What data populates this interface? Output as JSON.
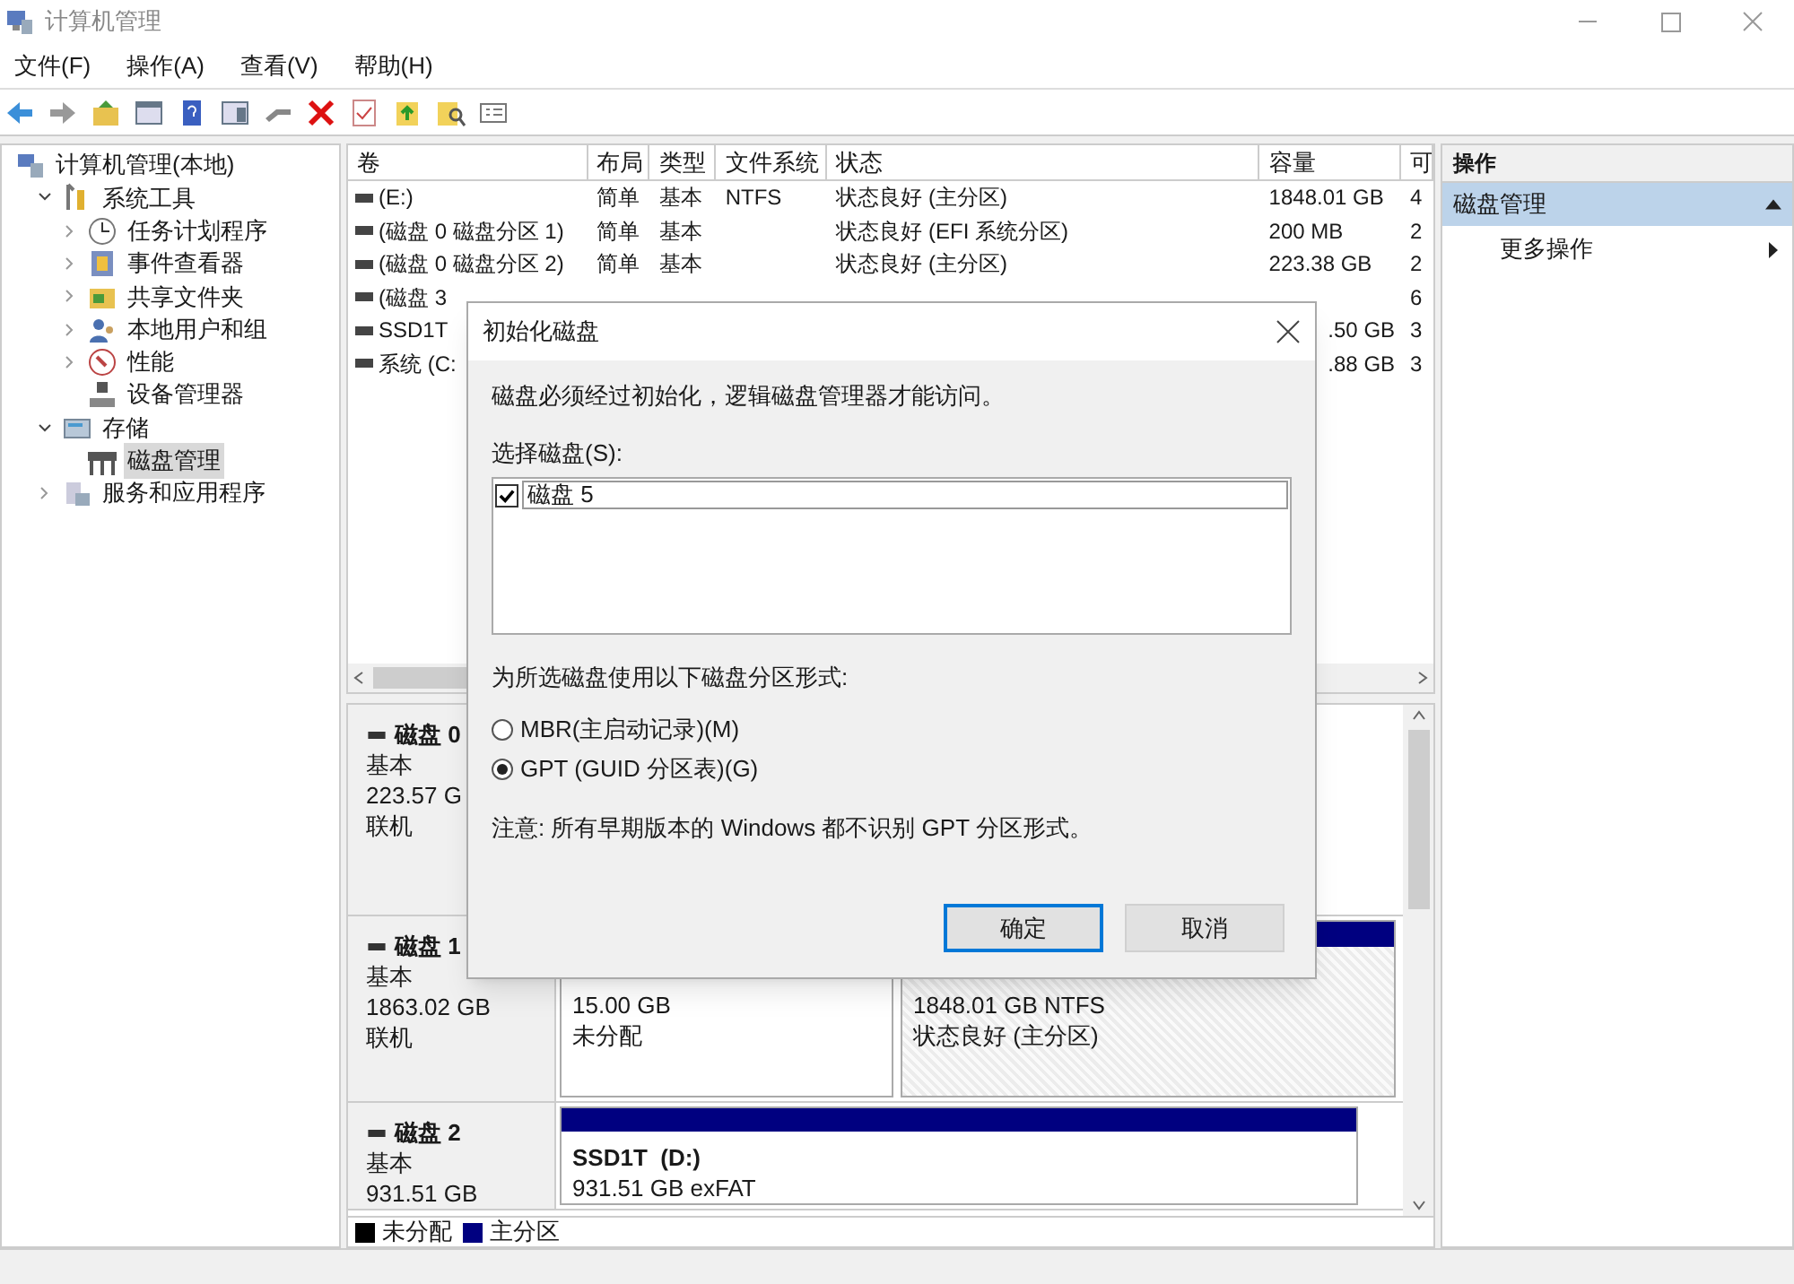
{
  "window": {
    "title": "计算机管理"
  },
  "menu": [
    "文件(F)",
    "操作(A)",
    "查看(V)",
    "帮助(H)"
  ],
  "tree": [
    {
      "label": "计算机管理(本地)",
      "selected": false,
      "children": [
        {
          "label": "系统工具",
          "expanded": true,
          "selected": false,
          "children": [
            {
              "label": "任务计划程序",
              "expanded": false,
              "selected": false
            },
            {
              "label": "事件查看器",
              "expanded": false,
              "selected": false
            },
            {
              "label": "共享文件夹",
              "expanded": false,
              "selected": false
            },
            {
              "label": "本地用户和组",
              "expanded": false,
              "selected": false
            },
            {
              "label": "性能",
              "expanded": false,
              "selected": false
            },
            {
              "label": "设备管理器",
              "selected": false
            }
          ]
        },
        {
          "label": "存储",
          "expanded": true,
          "selected": false,
          "children": [
            {
              "label": "磁盘管理",
              "selected": true
            }
          ]
        },
        {
          "label": "服务和应用程序",
          "expanded": false,
          "selected": false
        }
      ]
    }
  ],
  "table": {
    "columns": [
      "卷",
      "布局",
      "类型",
      "文件系统",
      "状态",
      "容量",
      "可"
    ],
    "rows": [
      {
        "cells": [
          "(E:)",
          "简单",
          "基本",
          "NTFS",
          "状态良好 (主分区)",
          "1848.01 GB",
          "4"
        ]
      },
      {
        "cells": [
          "(磁盘 0 磁盘分区 1)",
          "简单",
          "基本",
          null,
          "状态良好 (EFI 系统分区)",
          "200 MB",
          "2"
        ]
      },
      {
        "cells": [
          "(磁盘 0 磁盘分区 2)",
          "简单",
          "基本",
          null,
          "状态良好 (主分区)",
          "223.38 GB",
          "2"
        ]
      },
      {
        "cells": [
          "(磁盘 3",
          null,
          null,
          null,
          null,
          null,
          "6"
        ]
      },
      {
        "cells": [
          "SSD1T",
          null,
          null,
          null,
          null,
          ".50 GB",
          "3"
        ]
      },
      {
        "cells": [
          "系统 (C:",
          null,
          null,
          null,
          null,
          ".88 GB",
          "3"
        ]
      }
    ]
  },
  "disks": [
    {
      "name": "磁盘 0",
      "type": "基本",
      "size": "223.57 G",
      "status": "联机"
    },
    {
      "name": "磁盘 1",
      "type": "基本",
      "size": "1863.02 GB",
      "status": "联机",
      "partitions": [
        {
          "kind": "unallocated",
          "size": "15.00 GB",
          "status": "未分配",
          "selected": false
        },
        {
          "kind": "primary",
          "size": "1848.01 GB NTFS",
          "status": "状态良好 (主分区)",
          "selected": true
        }
      ]
    },
    {
      "name": "磁盘 2",
      "type": "基本",
      "size": "931.51 GB",
      "partitions": [
        {
          "kind": "primary",
          "label": "SSD1T  (D:)",
          "size": "931.51 GB exFAT",
          "selected": false
        }
      ]
    }
  ],
  "legend": [
    {
      "label": "未分配",
      "color": "#000000"
    },
    {
      "label": "主分区",
      "color": "#000080"
    }
  ],
  "actions": {
    "header": "操作",
    "items": [
      {
        "kind": "section",
        "label": "磁盘管理",
        "expanded": true
      },
      {
        "kind": "item",
        "label": "更多操作"
      }
    ]
  },
  "dialog": {
    "title": "初始化磁盘",
    "message": "磁盘必须经过初始化，逻辑磁盘管理器才能访问。",
    "select_label": "选择磁盘(S):",
    "disks": [
      {
        "label": "磁盘 5",
        "checked": true
      }
    ],
    "style_label": "为所选磁盘使用以下磁盘分区形式:",
    "options": [
      {
        "label": "MBR(主启动记录)(M)",
        "selected": false
      },
      {
        "label": "GPT (GUID 分区表)(G)",
        "selected": true
      }
    ],
    "note": "注意: 所有早期版本的 Windows 都不识别 GPT 分区形式。",
    "buttons": [
      {
        "label": "确定",
        "default": true
      },
      {
        "label": "取消",
        "default": false
      }
    ]
  }
}
